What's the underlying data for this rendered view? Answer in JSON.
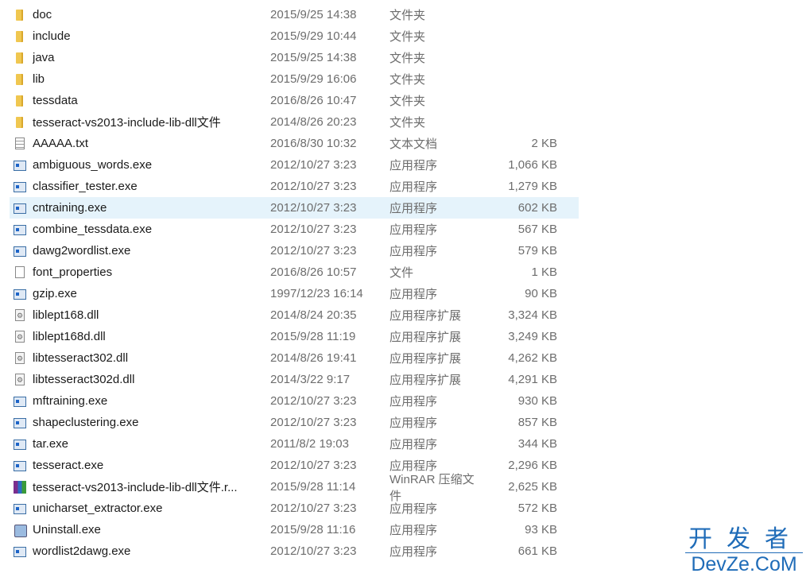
{
  "files": [
    {
      "name": "doc",
      "date": "2015/9/25 14:38",
      "type": "文件夹",
      "size": "",
      "icon": "folder"
    },
    {
      "name": "include",
      "date": "2015/9/29 10:44",
      "type": "文件夹",
      "size": "",
      "icon": "folder"
    },
    {
      "name": "java",
      "date": "2015/9/25 14:38",
      "type": "文件夹",
      "size": "",
      "icon": "folder"
    },
    {
      "name": "lib",
      "date": "2015/9/29 16:06",
      "type": "文件夹",
      "size": "",
      "icon": "folder"
    },
    {
      "name": "tessdata",
      "date": "2016/8/26 10:47",
      "type": "文件夹",
      "size": "",
      "icon": "folder"
    },
    {
      "name": "tesseract-vs2013-include-lib-dll文件",
      "date": "2014/8/26 20:23",
      "type": "文件夹",
      "size": "",
      "icon": "folder"
    },
    {
      "name": "AAAAA.txt",
      "date": "2016/8/30 10:32",
      "type": "文本文档",
      "size": "2 KB",
      "icon": "txt"
    },
    {
      "name": "ambiguous_words.exe",
      "date": "2012/10/27 3:23",
      "type": "应用程序",
      "size": "1,066 KB",
      "icon": "exe"
    },
    {
      "name": "classifier_tester.exe",
      "date": "2012/10/27 3:23",
      "type": "应用程序",
      "size": "1,279 KB",
      "icon": "exe"
    },
    {
      "name": "cntraining.exe",
      "date": "2012/10/27 3:23",
      "type": "应用程序",
      "size": "602 KB",
      "icon": "exe",
      "selected": true
    },
    {
      "name": "combine_tessdata.exe",
      "date": "2012/10/27 3:23",
      "type": "应用程序",
      "size": "567 KB",
      "icon": "exe"
    },
    {
      "name": "dawg2wordlist.exe",
      "date": "2012/10/27 3:23",
      "type": "应用程序",
      "size": "579 KB",
      "icon": "exe"
    },
    {
      "name": "font_properties",
      "date": "2016/8/26 10:57",
      "type": "文件",
      "size": "1 KB",
      "icon": "file"
    },
    {
      "name": "gzip.exe",
      "date": "1997/12/23 16:14",
      "type": "应用程序",
      "size": "90 KB",
      "icon": "exe"
    },
    {
      "name": "liblept168.dll",
      "date": "2014/8/24 20:35",
      "type": "应用程序扩展",
      "size": "3,324 KB",
      "icon": "dll"
    },
    {
      "name": "liblept168d.dll",
      "date": "2015/9/28 11:19",
      "type": "应用程序扩展",
      "size": "3,249 KB",
      "icon": "dll"
    },
    {
      "name": "libtesseract302.dll",
      "date": "2014/8/26 19:41",
      "type": "应用程序扩展",
      "size": "4,262 KB",
      "icon": "dll"
    },
    {
      "name": "libtesseract302d.dll",
      "date": "2014/3/22 9:17",
      "type": "应用程序扩展",
      "size": "4,291 KB",
      "icon": "dll"
    },
    {
      "name": "mftraining.exe",
      "date": "2012/10/27 3:23",
      "type": "应用程序",
      "size": "930 KB",
      "icon": "exe"
    },
    {
      "name": "shapeclustering.exe",
      "date": "2012/10/27 3:23",
      "type": "应用程序",
      "size": "857 KB",
      "icon": "exe"
    },
    {
      "name": "tar.exe",
      "date": "2011/8/2 19:03",
      "type": "应用程序",
      "size": "344 KB",
      "icon": "exe"
    },
    {
      "name": "tesseract.exe",
      "date": "2012/10/27 3:23",
      "type": "应用程序",
      "size": "2,296 KB",
      "icon": "exe"
    },
    {
      "name": "tesseract-vs2013-include-lib-dll文件.r...",
      "date": "2015/9/28 11:14",
      "type": "WinRAR 压缩文件",
      "size": "2,625 KB",
      "icon": "rar"
    },
    {
      "name": "unicharset_extractor.exe",
      "date": "2012/10/27 3:23",
      "type": "应用程序",
      "size": "572 KB",
      "icon": "exe"
    },
    {
      "name": "Uninstall.exe",
      "date": "2015/9/28 11:16",
      "type": "应用程序",
      "size": "93 KB",
      "icon": "uninst"
    },
    {
      "name": "wordlist2dawg.exe",
      "date": "2012/10/27 3:23",
      "type": "应用程序",
      "size": "661 KB",
      "icon": "exe"
    }
  ],
  "watermark": {
    "cn": "开发者",
    "en": "DevZe.CoM"
  }
}
